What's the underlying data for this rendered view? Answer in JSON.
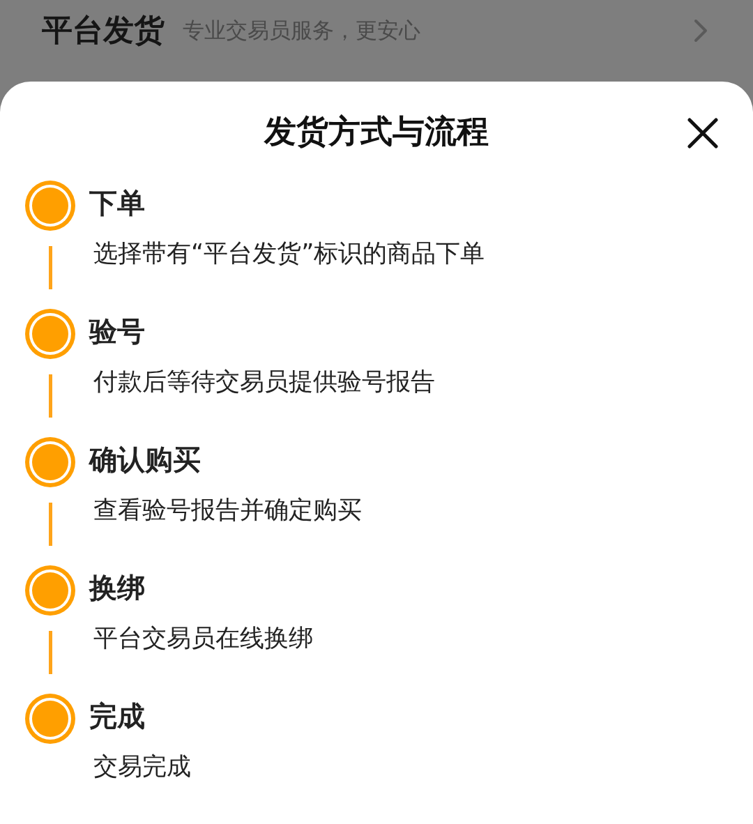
{
  "background_row": {
    "title": "平台发货",
    "subtitle": "专业交易员服务，更安心"
  },
  "sheet": {
    "title": "发货方式与流程"
  },
  "steps": [
    {
      "title": "下单",
      "description": "选择带有“平台发货”标识的商品下单"
    },
    {
      "title": "验号",
      "description": "付款后等待交易员提供验号报告"
    },
    {
      "title": "确认购买",
      "description": "查看验号报告并确定购买"
    },
    {
      "title": "换绑",
      "description": "平台交易员在线换绑"
    },
    {
      "title": "完成",
      "description": "交易完成"
    }
  ]
}
